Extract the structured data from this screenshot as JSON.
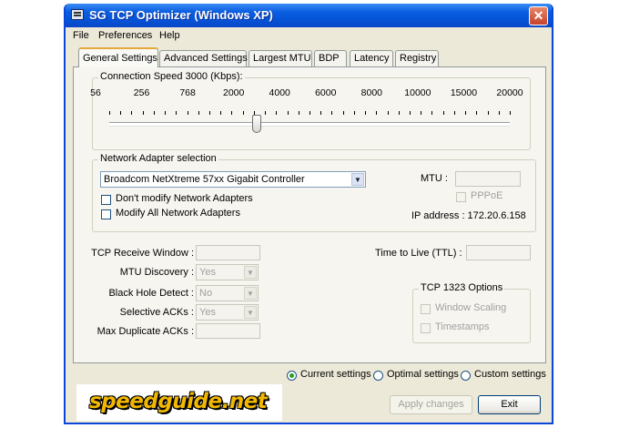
{
  "window": {
    "title": "SG TCP Optimizer (Windows XP)",
    "close_glyph": "✕"
  },
  "menu": [
    "File",
    "Preferences",
    "Help"
  ],
  "tabs": [
    "General Settings",
    "Advanced Settings",
    "Largest MTU",
    "BDP",
    "Latency",
    "Registry"
  ],
  "connection": {
    "legend": "Connection Speed  3000 (Kbps):",
    "value_kbps": 3000,
    "ticks": [
      "56",
      "256",
      "768",
      "2000",
      "4000",
      "6000",
      "8000",
      "10000",
      "15000",
      "20000"
    ]
  },
  "adapter": {
    "legend": "Network Adapter selection",
    "selected": "Broadcom NetXtreme 57xx Gigabit Controller",
    "dont_modify": "Don't modify Network Adapters",
    "modify_all": "Modify All Network Adapters",
    "mtu_label": "MTU :",
    "pppoe": "PPPoE",
    "ip": "IP address : 172.20.6.158"
  },
  "settings": {
    "rwin": "TCP Receive Window :",
    "mtu_discovery": "MTU Discovery :",
    "mtu_discovery_value": "Yes",
    "black_hole": "Black Hole Detect :",
    "black_hole_value": "No",
    "sack": "Selective ACKs :",
    "sack_value": "Yes",
    "max_dup": "Max Duplicate ACKs :",
    "ttl": "Time to Live (TTL) :"
  },
  "tcp1323": {
    "legend": "TCP 1323 Options",
    "window_scaling": "Window Scaling",
    "timestamps": "Timestamps"
  },
  "mode": {
    "current": "Current settings",
    "optimal": "Optimal settings",
    "custom": "Custom settings",
    "selected": "current"
  },
  "buttons": {
    "apply": "Apply changes",
    "exit": "Exit"
  },
  "logo": {
    "text": "speedguide.net"
  },
  "colors": {
    "titlebar": "#0553d6",
    "face": "#ece9d8",
    "tab_accent": "#e6a83c"
  }
}
